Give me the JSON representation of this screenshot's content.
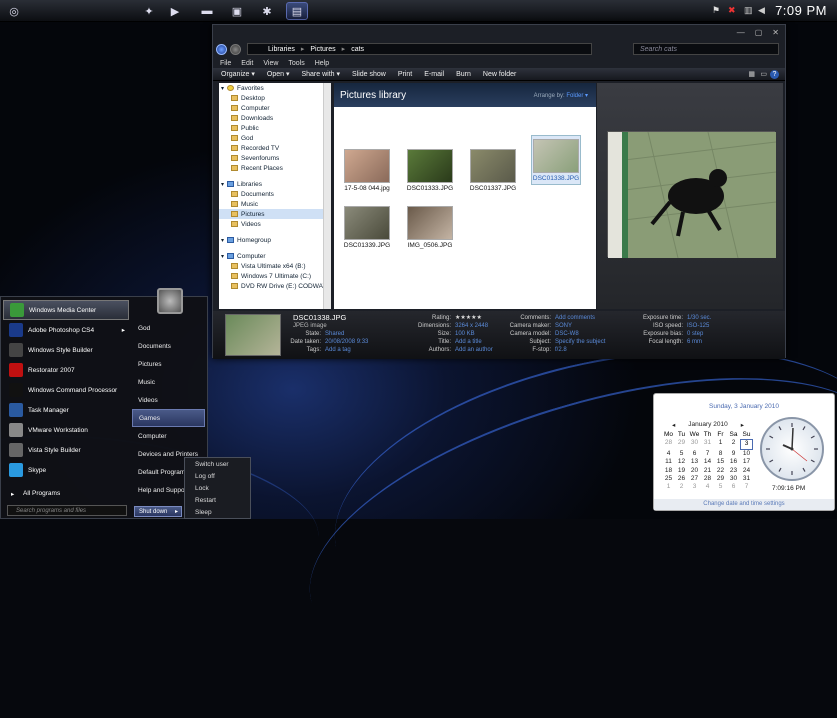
{
  "taskbar": {
    "clock": "7:09 PM",
    "tray_icons": [
      "flag-icon",
      "x-icon",
      "network-icon",
      "volume-icon"
    ]
  },
  "explorer": {
    "breadcrumb": [
      "Libraries",
      "Pictures",
      "cats"
    ],
    "search_placeholder": "Search cats",
    "menu": [
      "File",
      "Edit",
      "View",
      "Tools",
      "Help"
    ],
    "commands": [
      "Organize ▾",
      "Open ▾",
      "Share with ▾",
      "Slide show",
      "Print",
      "E-mail",
      "Burn",
      "New folder"
    ],
    "nav": [
      {
        "label": "Favorites",
        "top": true,
        "icon": "star"
      },
      {
        "label": "Desktop"
      },
      {
        "label": "Computer"
      },
      {
        "label": "Downloads"
      },
      {
        "label": "Public"
      },
      {
        "label": "God"
      },
      {
        "label": "Recorded TV"
      },
      {
        "label": "Sevenforums"
      },
      {
        "label": "Recent Places"
      },
      {
        "label": "",
        "spacer": true
      },
      {
        "label": "Libraries",
        "top": true
      },
      {
        "label": "Documents"
      },
      {
        "label": "Music"
      },
      {
        "label": "Pictures",
        "selected": true
      },
      {
        "label": "Videos"
      },
      {
        "label": "",
        "spacer": true
      },
      {
        "label": "Homegroup",
        "top": true
      },
      {
        "label": "",
        "spacer": true
      },
      {
        "label": "Computer",
        "top": true
      },
      {
        "label": "Vista Ultimate x64 (B:)"
      },
      {
        "label": "Windows 7 Ultimate (C:)"
      },
      {
        "label": "DVD RW Drive (E:) CODWAW"
      }
    ],
    "library_title": "Pictures library",
    "arrange_by": "Arrange by:",
    "arrange_value": "Folder ▾",
    "files": [
      "17-5-08 044.jpg",
      "DSC01333.JPG",
      "DSC01337.JPG",
      "DSC01338.JPG",
      "DSC01339.JPG",
      "IMG_0506.JPG"
    ],
    "details": {
      "name": "DSC01338.JPG",
      "type": "JPEG image",
      "col1": [
        [
          "State:",
          "Shared"
        ],
        [
          "Date taken:",
          "20/08/2008 9:33"
        ],
        [
          "Tags:",
          "Add a tag"
        ]
      ],
      "col2": [
        [
          "Rating:",
          "★★★★★"
        ],
        [
          "Dimensions:",
          "3264 x 2448"
        ],
        [
          "Size:",
          "100 KB"
        ],
        [
          "Title:",
          "Add a title"
        ],
        [
          "Authors:",
          "Add an author"
        ]
      ],
      "col3": [
        [
          "Comments:",
          "Add comments"
        ],
        [
          "Camera maker:",
          "SONY"
        ],
        [
          "Camera model:",
          "DSC-W8"
        ],
        [
          "Subject:",
          "Specify the subject"
        ],
        [
          "F-stop:",
          "f/2.8"
        ]
      ],
      "col4": [
        [
          "Exposure time:",
          "1/30 sec."
        ],
        [
          "ISO speed:",
          "ISO-125"
        ],
        [
          "Exposure bias:",
          "0 step"
        ],
        [
          "Focal length:",
          "6 mm"
        ]
      ]
    }
  },
  "start_menu": {
    "left": [
      {
        "label": "Windows Media Center",
        "color": "#3a9a3a",
        "hi": true
      },
      {
        "label": "Adobe Photoshop CS4",
        "color": "#1a3a8a"
      },
      {
        "label": "Windows Style Builder",
        "color": "#444"
      },
      {
        "label": "Restorator 2007",
        "color": "#c01010"
      },
      {
        "label": "Windows Command Processor",
        "color": "#111"
      },
      {
        "label": "Task Manager",
        "color": "#2a5aa0"
      },
      {
        "label": "VMware Workstation",
        "color": "#888"
      },
      {
        "label": "Vista Style Builder",
        "color": "#666"
      },
      {
        "label": "Skype",
        "color": "#2a9ae0"
      }
    ],
    "right": [
      "God",
      "Documents",
      "Pictures",
      "Music",
      "Videos",
      "Games",
      "Computer",
      "Devices and Printers",
      "Default Programs",
      "Help and Support"
    ],
    "right_highlight": "Games",
    "all_programs": "All Programs",
    "search_placeholder": "Search programs and files",
    "shutdown_label": "Shut down",
    "power_options": [
      "Switch user",
      "Log off",
      "Lock",
      "Restart",
      "Sleep"
    ]
  },
  "calendar_gadget": {
    "full_date": "Sunday, 3 January 2010",
    "month": "January 2010",
    "weekdays": [
      "Mo",
      "Tu",
      "We",
      "Th",
      "Fr",
      "Sa",
      "Su"
    ],
    "days": [
      [
        "28",
        "o"
      ],
      [
        "29",
        "o"
      ],
      [
        "30",
        "o"
      ],
      [
        "31",
        "o"
      ],
      [
        "1",
        ""
      ],
      [
        "2",
        ""
      ],
      [
        "3",
        "t"
      ],
      [
        "4",
        ""
      ],
      [
        "5",
        ""
      ],
      [
        "6",
        ""
      ],
      [
        "7",
        ""
      ],
      [
        "8",
        ""
      ],
      [
        "9",
        ""
      ],
      [
        "10",
        ""
      ],
      [
        "11",
        ""
      ],
      [
        "12",
        ""
      ],
      [
        "13",
        ""
      ],
      [
        "14",
        ""
      ],
      [
        "15",
        ""
      ],
      [
        "16",
        ""
      ],
      [
        "17",
        ""
      ],
      [
        "18",
        ""
      ],
      [
        "19",
        ""
      ],
      [
        "20",
        ""
      ],
      [
        "21",
        ""
      ],
      [
        "22",
        ""
      ],
      [
        "23",
        ""
      ],
      [
        "24",
        ""
      ],
      [
        "25",
        ""
      ],
      [
        "26",
        ""
      ],
      [
        "27",
        ""
      ],
      [
        "28",
        ""
      ],
      [
        "29",
        ""
      ],
      [
        "30",
        ""
      ],
      [
        "31",
        ""
      ],
      [
        "1",
        "o"
      ],
      [
        "2",
        "o"
      ],
      [
        "3",
        "o"
      ],
      [
        "4",
        "o"
      ],
      [
        "5",
        "o"
      ],
      [
        "6",
        "o"
      ],
      [
        "7",
        "o"
      ]
    ],
    "clock_time": "7:09:16 PM",
    "footer": "Change date and time settings"
  }
}
